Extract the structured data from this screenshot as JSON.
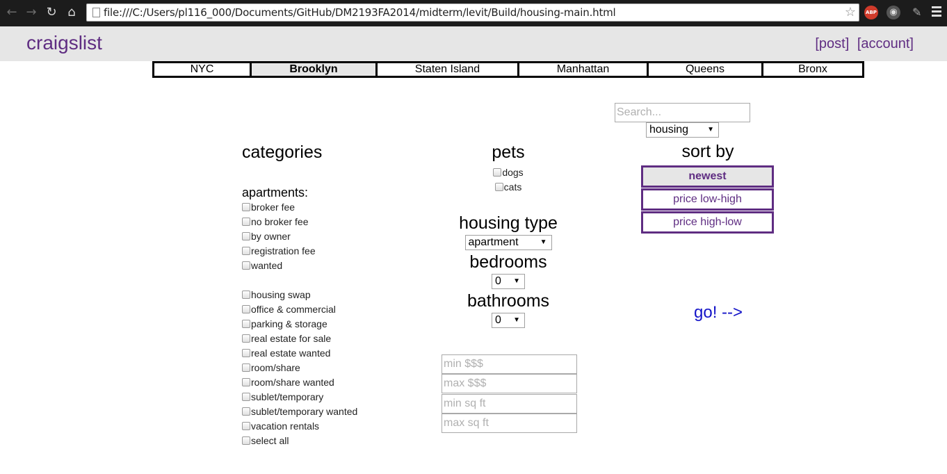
{
  "browser": {
    "url": "file:///C:/Users/pl116_000/Documents/GitHub/DM2193FA2014/midterm/levit/Build/housing-main.html",
    "extensions": [
      "ABP"
    ]
  },
  "header": {
    "logo": "craigslist",
    "links": [
      "[post]",
      "[account]"
    ]
  },
  "tabs": [
    {
      "label": "NYC",
      "active": false
    },
    {
      "label": "Brooklyn",
      "active": true
    },
    {
      "label": "Staten Island",
      "active": false
    },
    {
      "label": "Manhattan",
      "active": false
    },
    {
      "label": "Queens",
      "active": false
    },
    {
      "label": "Bronx",
      "active": false
    }
  ],
  "categories": {
    "title": "categories",
    "subheading": "apartments:",
    "apartment_options": [
      "broker fee",
      "no broker fee",
      "by owner",
      "registration fee",
      "wanted"
    ],
    "other_options": [
      "housing swap",
      "office & commercial",
      "parking & storage",
      "real estate for sale",
      "real estate wanted",
      "room/share",
      "room/share wanted",
      "sublet/temporary",
      "sublet/temporary wanted",
      "vacation rentals",
      "select all"
    ]
  },
  "pets": {
    "title": "pets",
    "options": [
      "dogs",
      "cats"
    ]
  },
  "housing_type": {
    "title": "housing type",
    "value": "apartment"
  },
  "bedrooms": {
    "title": "bedrooms",
    "value": "0"
  },
  "bathrooms": {
    "title": "bathrooms",
    "value": "0"
  },
  "filters": {
    "min_price_placeholder": "min $$$",
    "max_price_placeholder": "max $$$",
    "min_sqft_placeholder": "min sq ft",
    "max_sqft_placeholder": "max sq ft"
  },
  "search": {
    "placeholder": "Search...",
    "category": "housing"
  },
  "sort": {
    "title": "sort by",
    "options": [
      {
        "label": "newest",
        "active": true
      },
      {
        "label": "price low-high",
        "active": false
      },
      {
        "label": "price high-low",
        "active": false
      }
    ]
  },
  "go_label": "go! -->"
}
